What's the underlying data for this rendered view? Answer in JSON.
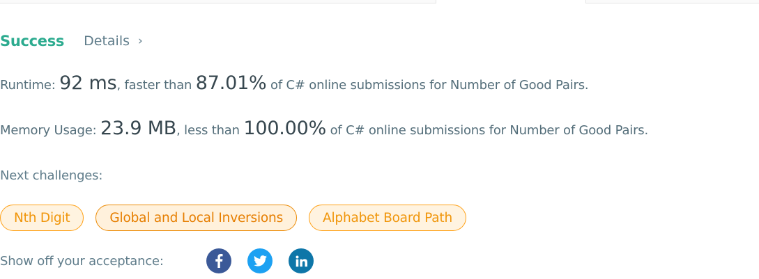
{
  "status": {
    "result": "Success",
    "details_label": "Details",
    "details_chevron": "›"
  },
  "runtime": {
    "label": "Runtime: ",
    "value": "92 ms",
    "comparison": ", faster than ",
    "percent": "87.01%",
    "suffix": " of C# online submissions for Number of Good Pairs."
  },
  "memory": {
    "label": "Memory Usage: ",
    "value": "23.9 MB",
    "comparison": ", less than ",
    "percent": "100.00%",
    "suffix": " of C# online submissions for Number of Good Pairs."
  },
  "next_challenges": {
    "label": "Next challenges:",
    "items": [
      {
        "label": "Nth Digit"
      },
      {
        "label": "Global and Local Inversions"
      },
      {
        "label": "Alphabet Board Path"
      }
    ]
  },
  "share": {
    "label": "Show off your acceptance:",
    "icons": [
      "facebook-icon",
      "twitter-icon",
      "linkedin-icon"
    ]
  },
  "colors": {
    "success": "#2cab8f",
    "chip_border": "#ffa116",
    "chip_text": "#f0960b",
    "facebook": "#3b5998",
    "twitter": "#1da1f2",
    "linkedin": "#0e76a8"
  }
}
